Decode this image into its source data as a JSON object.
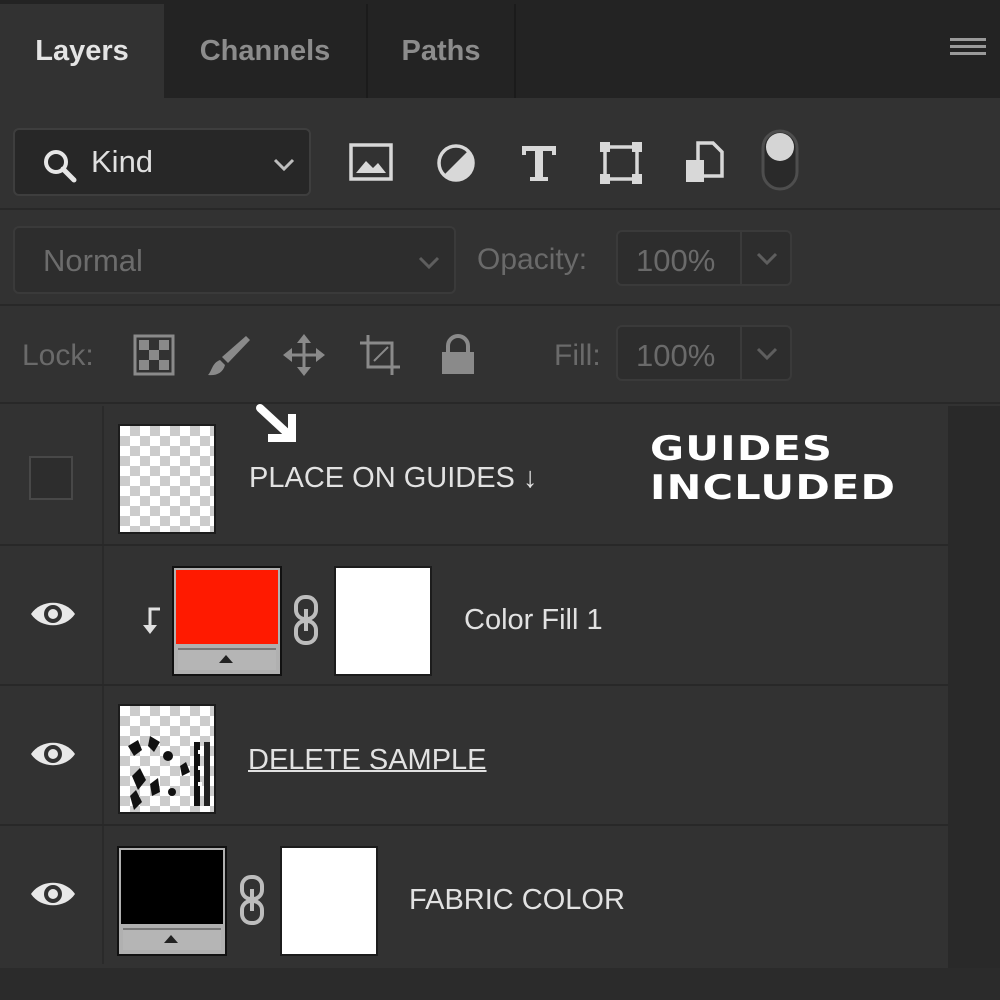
{
  "tabs": [
    {
      "label": "Layers",
      "active": true
    },
    {
      "label": "Channels",
      "active": false
    },
    {
      "label": "Paths",
      "active": false
    }
  ],
  "filter": {
    "kind_label": "Kind",
    "icons": [
      "pixel-layer-filter-icon",
      "adjustment-layer-filter-icon",
      "type-layer-filter-icon",
      "shape-layer-filter-icon",
      "smart-object-filter-icon",
      "filter-toggle-icon"
    ]
  },
  "blend": {
    "mode": "Normal",
    "opacity_label": "Opacity:",
    "opacity_value": "100%"
  },
  "lock": {
    "label": "Lock:",
    "icons": [
      "lock-transparent-pixels-icon",
      "lock-image-pixels-icon",
      "lock-position-icon",
      "lock-artboard-icon",
      "lock-all-icon"
    ],
    "fill_label": "Fill:",
    "fill_value": "100%"
  },
  "layers": [
    {
      "name": "PLACE ON GUIDES ↓",
      "visible": false,
      "type": "transparent"
    },
    {
      "name": "Color Fill 1",
      "visible": true,
      "type": "color-fill",
      "fill_color": "#ff1a00",
      "clipped": true
    },
    {
      "name": "DELETE SAMPLE",
      "visible": true,
      "type": "sample"
    },
    {
      "name": "FABRIC COLOR",
      "visible": true,
      "type": "color-fill",
      "fill_color": "#000000"
    }
  ],
  "promo": {
    "line1": "GUIDES",
    "line2": "INCLUDED"
  },
  "colors": {
    "panel_bg": "#323232",
    "tab_bar_bg": "#232323",
    "accent_red": "#ff1a00"
  }
}
